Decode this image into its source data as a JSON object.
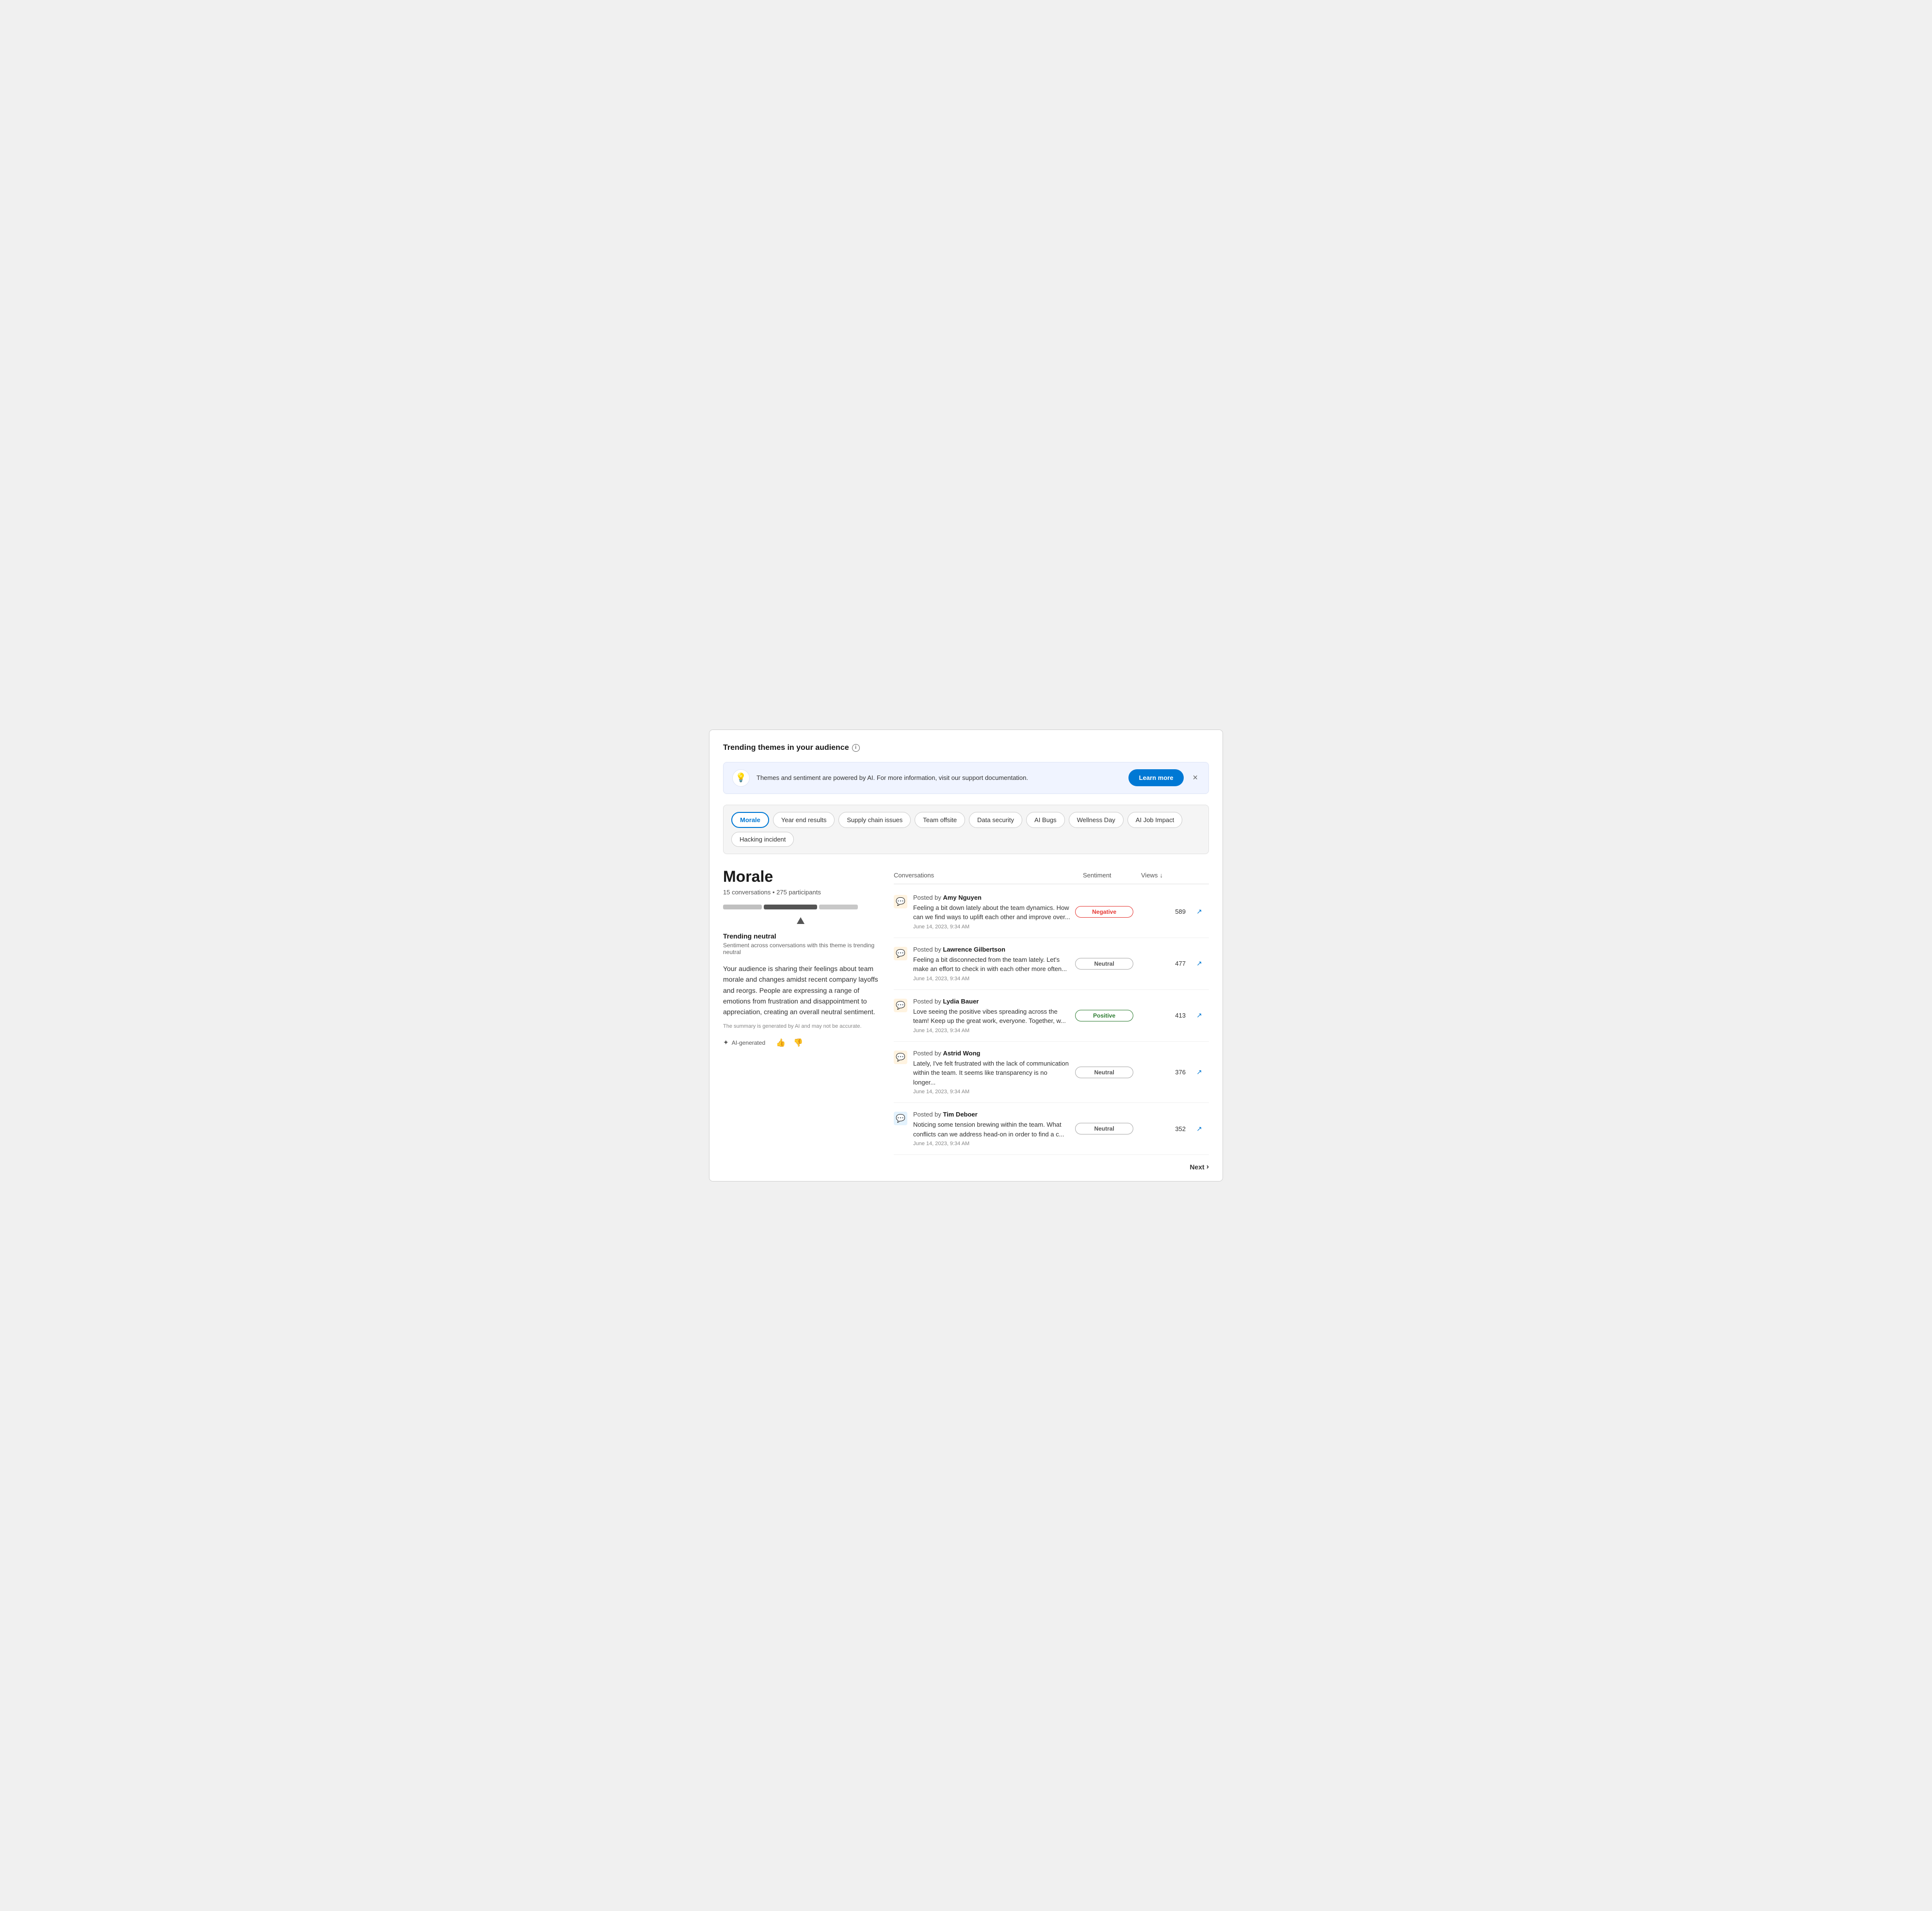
{
  "page": {
    "title": "Trending themes in your audience"
  },
  "banner": {
    "text": "Themes and sentiment are powered by AI. For more information, visit our support documentation.",
    "learn_more": "Learn more",
    "close_label": "×"
  },
  "tabs": [
    {
      "id": "morale",
      "label": "Morale",
      "active": true
    },
    {
      "id": "year-end-results",
      "label": "Year end results",
      "active": false
    },
    {
      "id": "supply-chain-issues",
      "label": "Supply chain issues",
      "active": false
    },
    {
      "id": "team-offsite",
      "label": "Team offsite",
      "active": false
    },
    {
      "id": "data-security",
      "label": "Data security",
      "active": false
    },
    {
      "id": "ai-bugs",
      "label": "AI Bugs",
      "active": false
    },
    {
      "id": "wellness-day",
      "label": "Wellness Day",
      "active": false
    },
    {
      "id": "ai-job-impact",
      "label": "AI Job Impact",
      "active": false
    },
    {
      "id": "hacking-incident",
      "label": "Hacking incident",
      "active": false
    }
  ],
  "theme": {
    "title": "Morale",
    "conversations_count": "15 conversations",
    "participants_count": "275 participants",
    "trending_label": "Trending neutral",
    "trending_sub": "Sentiment across conversations with this theme is trending neutral",
    "summary": "Your audience is sharing their feelings about team morale and changes amidst recent company layoffs and reorgs. People are expressing a range of emotions from frustration and disappointment to appreciation, creating an overall neutral sentiment.",
    "disclaimer": "The summary is generated by AI and may not be accurate.",
    "ai_generated": "AI-generated"
  },
  "table": {
    "col_conversations": "Conversations",
    "col_sentiment": "Sentiment",
    "col_views": "Views"
  },
  "conversations": [
    {
      "author": "Amy Nguyen",
      "text": "Feeling a bit down lately about the team dynamics. How can we find ways to uplift each other and improve over...",
      "date": "June 14, 2023, 9:34 AM",
      "sentiment": "Negative",
      "sentiment_type": "negative",
      "views": "589",
      "icon_type": "orange"
    },
    {
      "author": "Lawrence Gilbertson",
      "text": "Feeling a bit disconnected from the team lately. Let's make an effort to check in with each other more often...",
      "date": "June 14, 2023, 9:34 AM",
      "sentiment": "Neutral",
      "sentiment_type": "neutral",
      "views": "477",
      "icon_type": "orange"
    },
    {
      "author": "Lydia Bauer",
      "text": "Love seeing the positive vibes spreading across the team! Keep up the great work, everyone. Together, w...",
      "date": "June 14, 2023, 9:34 AM",
      "sentiment": "Positive",
      "sentiment_type": "positive",
      "views": "413",
      "icon_type": "orange"
    },
    {
      "author": "Astrid Wong",
      "text": "Lately, I've felt frustrated with the lack of communication within the team. It seems like transparency is no longer...",
      "date": "June 14, 2023, 9:34 AM",
      "sentiment": "Neutral",
      "sentiment_type": "neutral",
      "views": "376",
      "icon_type": "orange"
    },
    {
      "author": "Tim Deboer",
      "text": "Noticing some tension brewing within the team. What conflicts can we address head-on in order to find a c...",
      "date": "June 14, 2023, 9:34 AM",
      "sentiment": "Neutral",
      "sentiment_type": "neutral",
      "views": "352",
      "icon_type": "blue"
    }
  ],
  "pagination": {
    "next_label": "Next"
  }
}
